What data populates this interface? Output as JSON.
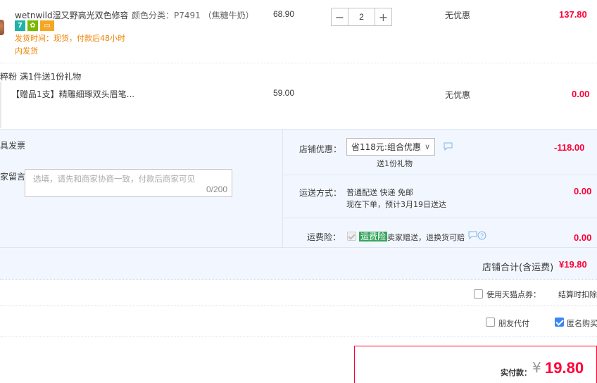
{
  "item1": {
    "title": "wetnwild湿又野高光双色修容...",
    "sku": "颜色分类：P7491 （焦糖牛奶）",
    "price": "68.90",
    "qty": "2",
    "promo": "无优惠",
    "total": "137.80",
    "badges": [
      {
        "text": "7",
        "color": "#20b2aa",
        "icon": "seven-day-return-icon"
      },
      {
        "text": "✿",
        "color": "#7ab800",
        "icon": "guarantee-icon"
      },
      {
        "text": "▭",
        "color": "#f5a623",
        "icon": "credit-card-icon"
      }
    ],
    "ship_line1": "发货时间：现货，付款后48小时",
    "ship_line2": "内发货"
  },
  "gift": {
    "tag": "粹粉",
    "note": "满1件送1份礼物",
    "name": "【赠品1支】精雕细琢双头眉笔...",
    "price": "59.00",
    "promo": "无优惠",
    "total": "0.00"
  },
  "left": {
    "invoice": "具发票",
    "message_label": "家留言：",
    "message_placeholder": "选填，请先和商家协商一致，付款后商家可见",
    "message_count": "0/200"
  },
  "store_discount": {
    "label": "店铺优惠：",
    "selected": "省118元:组合优惠",
    "sub": "送1份礼物",
    "amount": "-118.00"
  },
  "shipping": {
    "label": "运送方式：",
    "line1": "普通配送 快递 免邮",
    "line2": "现在下单，预计3月19日送达",
    "amount": "0.00"
  },
  "insurance": {
    "label": "运费险：",
    "tag": "运费险",
    "text": "卖家赠送，退换货可赔",
    "amount": "0.00"
  },
  "store_total": {
    "label": "店铺合计(含运费)",
    "amount": "¥19.80"
  },
  "points": {
    "label": "使用天猫点券：",
    "note": "结算时扣除"
  },
  "friend_pay": {
    "label": "朋友代付"
  },
  "anonymous": {
    "label": "匿名购买"
  },
  "final": {
    "label": "实付款：",
    "currency": "¥",
    "amount": "19.80"
  },
  "colors": {
    "accent_red": "#ff0036",
    "orange": "#f08200",
    "blue_bg": "#f2f7ff"
  }
}
